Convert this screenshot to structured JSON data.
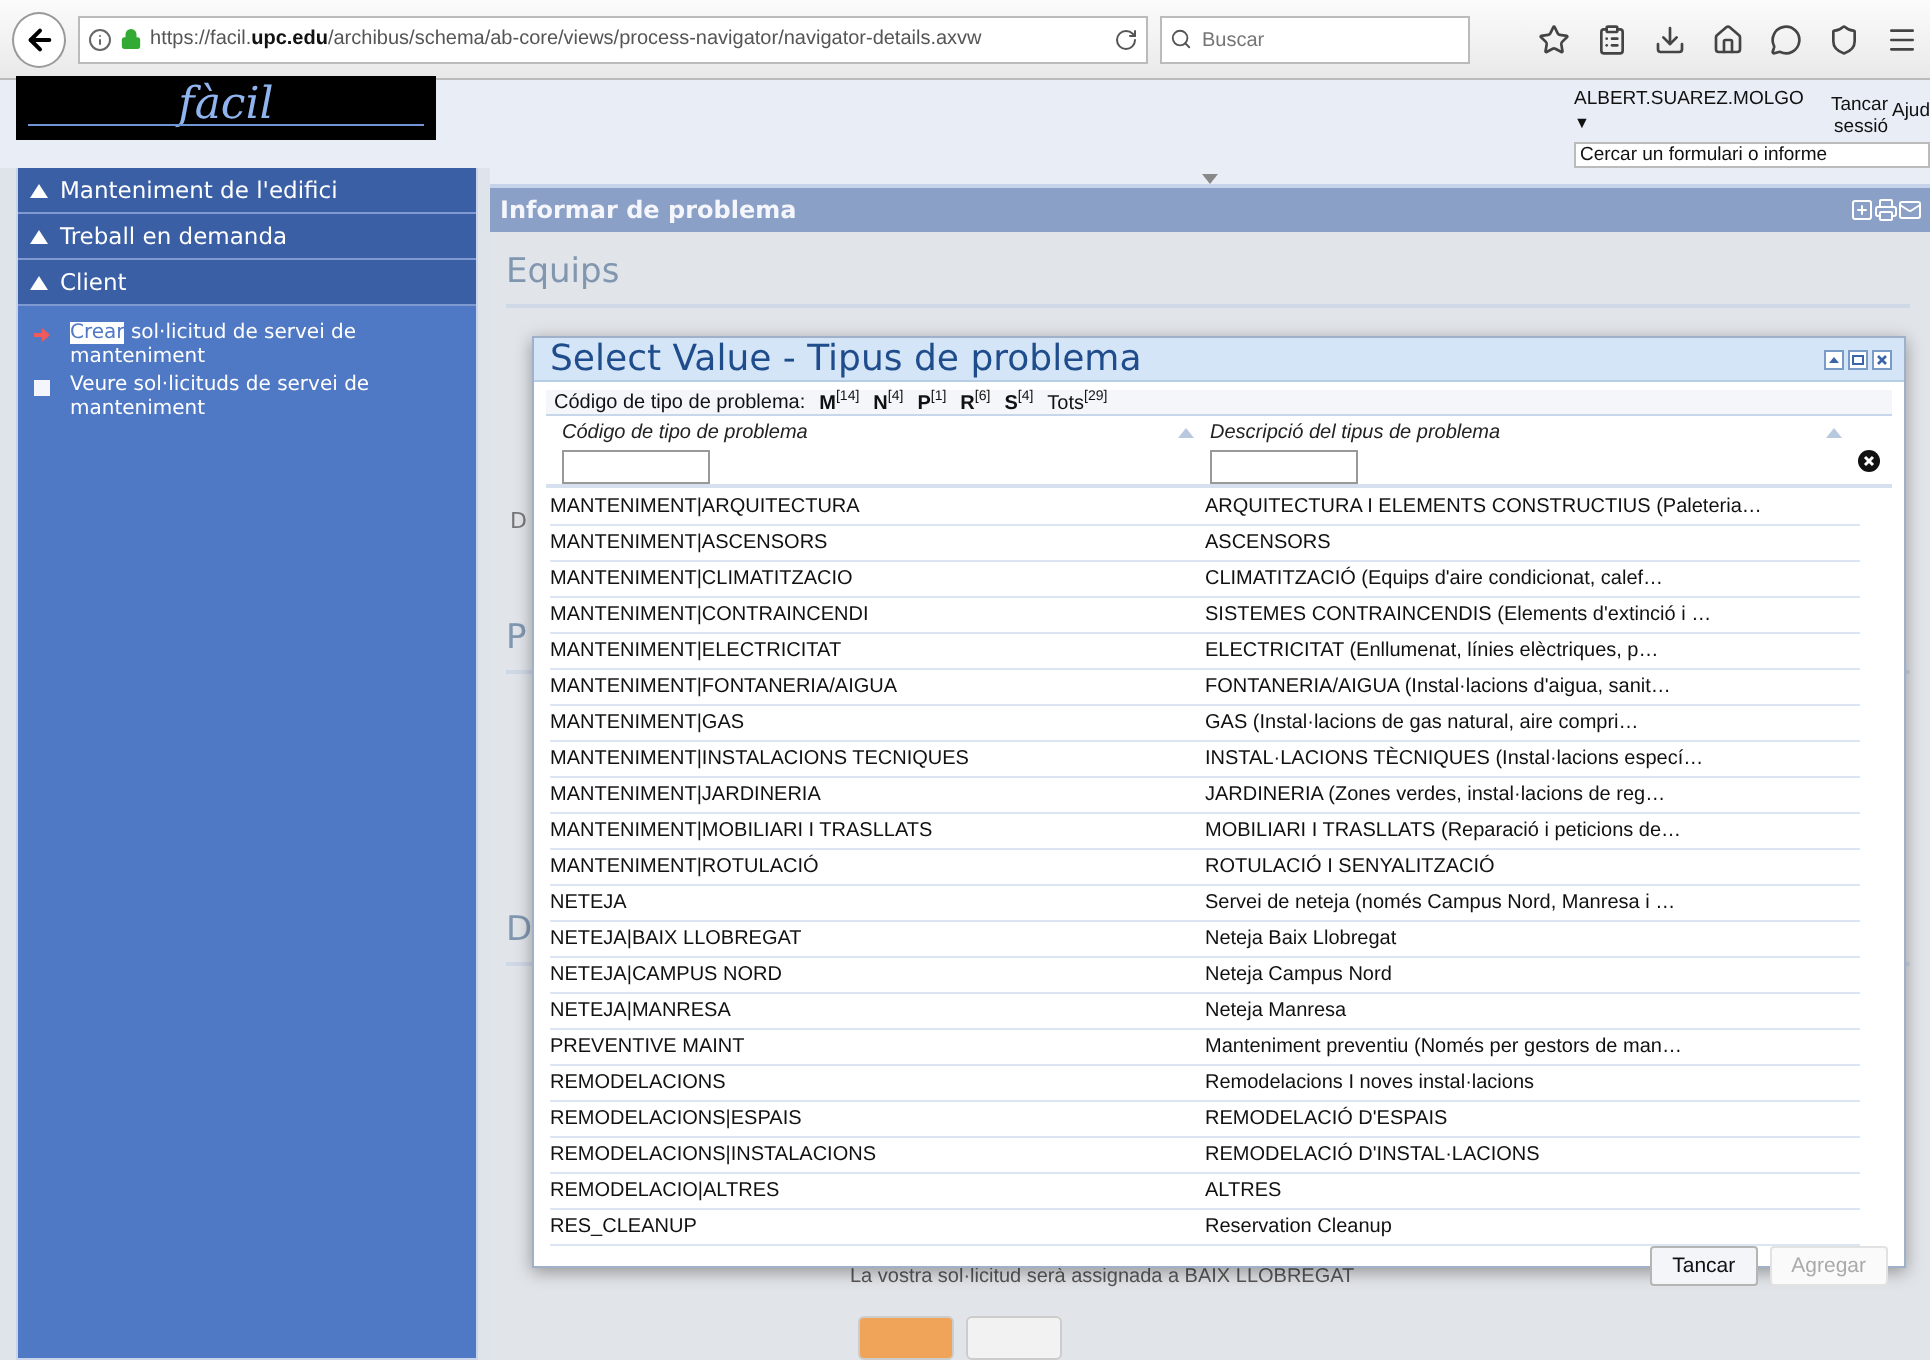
{
  "browser": {
    "url": "https://facil.**upc.edu**/archibus/schema/ab-core/views/process-navigator/navigator-details.axvw",
    "search": {
      "placeholder": "Buscar"
    }
  },
  "header": {
    "logo": "fàcil",
    "user": "ALBERT.SUAREZ.MOLGO",
    "user_menu": "▼",
    "logout": "Tancar sessió",
    "help": "Ajud",
    "search": {
      "placeholder": "Cercar un formulari o informe"
    }
  },
  "sidebar": {
    "sections": [
      {
        "label": "Manteniment de l'edifici"
      },
      {
        "label": "Treball en demanda"
      },
      {
        "label": "Client",
        "items": [
          {
            "highlight": "Crear",
            "text": " sol·licitud de servei de manteniment",
            "selected": true
          },
          {
            "text": "Veure sol·licituds de servei de manteniment",
            "selected": false
          }
        ]
      }
    ]
  },
  "main": {
    "title": "Informar de problema",
    "heading": "Equips",
    "field_label": "D",
    "sections": [
      "P",
      "D"
    ],
    "note": "La vostra sol·licitud serà assignada a BAIX LLOBREGAT"
  },
  "dialog": {
    "title": "Select Value - Tipus de problema",
    "filter_label": "Código de tipo de problema:",
    "filters": [
      "**M**$^{[14]}$",
      "**N**$^{[4]}$",
      "**P**$^{[1]}$",
      "**R**$^{[6]}$",
      "**S**$^{[4]}$",
      "Tots$^{[29]}$"
    ],
    "columns": [
      "Código de tipo de problema",
      "Descripció del tipus de problema"
    ],
    "rows": [
      [
        "MANTENIMENT|ARQUITECTURA",
        "ARQUITECTURA I ELEMENTS CONSTRUCTIUS (Paleteria…"
      ],
      [
        "MANTENIMENT|ASCENSORS",
        "ASCENSORS"
      ],
      [
        "MANTENIMENT|CLIMATITZACIO",
        "CLIMATITZACIÓ (Equips d'aire condicionat, calef…"
      ],
      [
        "MANTENIMENT|CONTRAINCENDI",
        "SISTEMES CONTRAINCENDIS (Elements d'extinció i …"
      ],
      [
        "MANTENIMENT|ELECTRICITAT",
        "ELECTRICITAT (Enllumenat, línies elèctriques, p…"
      ],
      [
        "MANTENIMENT|FONTANERIA/AIGUA",
        "FONTANERIA/AIGUA (Instal·lacions d'aigua, sanit…"
      ],
      [
        "MANTENIMENT|GAS",
        "GAS (Instal·lacions de gas natural, aire compri…"
      ],
      [
        "MANTENIMENT|INSTALACIONS TECNIQUES",
        "INSTAL·LACIONS TÈCNIQUES (Instal·lacions especí…"
      ],
      [
        "MANTENIMENT|JARDINERIA",
        "JARDINERIA (Zones verdes, instal·lacions de reg…"
      ],
      [
        "MANTENIMENT|MOBILIARI I TRASLLATS",
        "MOBILIARI I TRASLLATS (Reparació i peticions de…"
      ],
      [
        "MANTENIMENT|ROTULACIÓ",
        "ROTULACIÓ I SENYALITZACIÓ"
      ],
      [
        "NETEJA",
        "Servei de neteja (només Campus Nord, Manresa i …"
      ],
      [
        "NETEJA|BAIX LLOBREGAT",
        "Neteja Baix Llobregat"
      ],
      [
        "NETEJA|CAMPUS NORD",
        "Neteja Campus Nord"
      ],
      [
        "NETEJA|MANRESA",
        "Neteja Manresa"
      ],
      [
        "PREVENTIVE MAINT",
        "Manteniment preventiu (Només per gestors de man…"
      ],
      [
        "REMODELACIONS",
        "Remodelacions I noves instal·lacions"
      ],
      [
        "REMODELACIONS|ESPAIS",
        "REMODELACIÓ D'ESPAIS"
      ],
      [
        "REMODELACIONS|INSTALACIONS",
        "REMODELACIÓ D'INSTAL·LACIONS"
      ],
      [
        "REMODELACIO|ALTRES",
        "ALTRES"
      ],
      [
        "RES_CLEANUP",
        "Reservation Cleanup"
      ]
    ],
    "buttons": [
      {
        "label": "Tancar",
        "disabled": false
      },
      {
        "label": "Agregar",
        "disabled": true
      }
    ]
  }
}
